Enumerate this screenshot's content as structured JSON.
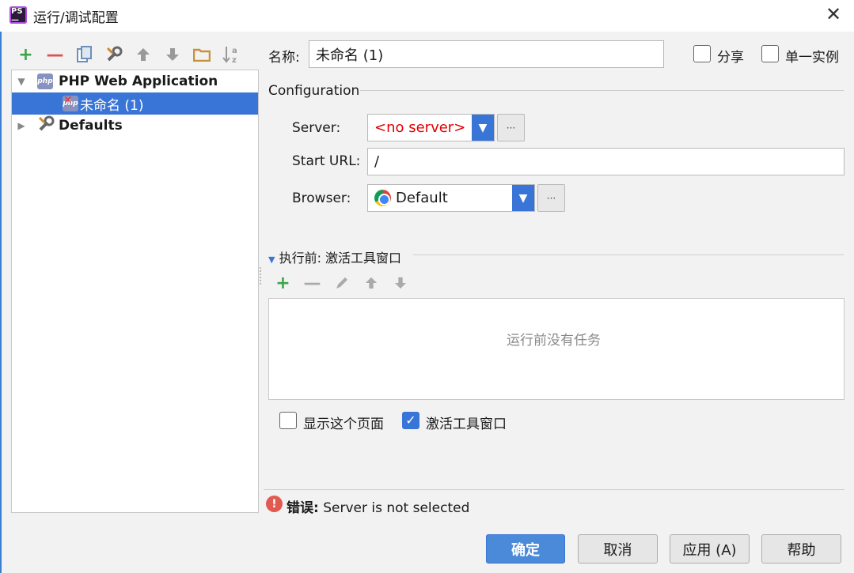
{
  "window": {
    "title": "运行/调试配置",
    "app_icon_text": "PS"
  },
  "toolbar": {
    "icons": [
      "add-icon",
      "remove-icon",
      "copy-icon",
      "wrench-icon",
      "move-up-icon",
      "move-down-icon",
      "folder-icon",
      "sort-az-icon"
    ]
  },
  "tree": {
    "group": "PHP Web Application",
    "child": "未命名 (1)",
    "defaults": "Defaults"
  },
  "form": {
    "name_label": "名称:",
    "name_value": "未命名 (1)",
    "share_label": "分享",
    "single_instance_label": "单一实例",
    "section_title": "Configuration",
    "server_label": "Server:",
    "server_value": "<no server>",
    "start_url_label": "Start URL:",
    "start_url_value": "/",
    "browser_label": "Browser:",
    "browser_value": "Default",
    "dots": "···"
  },
  "before_launch": {
    "title": "执行前: 激活工具窗口",
    "empty_text": "运行前没有任务",
    "show_page_label": "显示这个页面",
    "activate_window_label": "激活工具窗口"
  },
  "status": {
    "error_prefix": "错误:",
    "error_text": " Server is not selected"
  },
  "buttons": {
    "ok": "确定",
    "cancel": "取消",
    "apply": "应用 (A)",
    "help": "帮助"
  },
  "colors": {
    "accent": "#3875d7",
    "add_green": "#3aa548",
    "remove_red": "#d9534f",
    "server_red": "#e00000"
  }
}
